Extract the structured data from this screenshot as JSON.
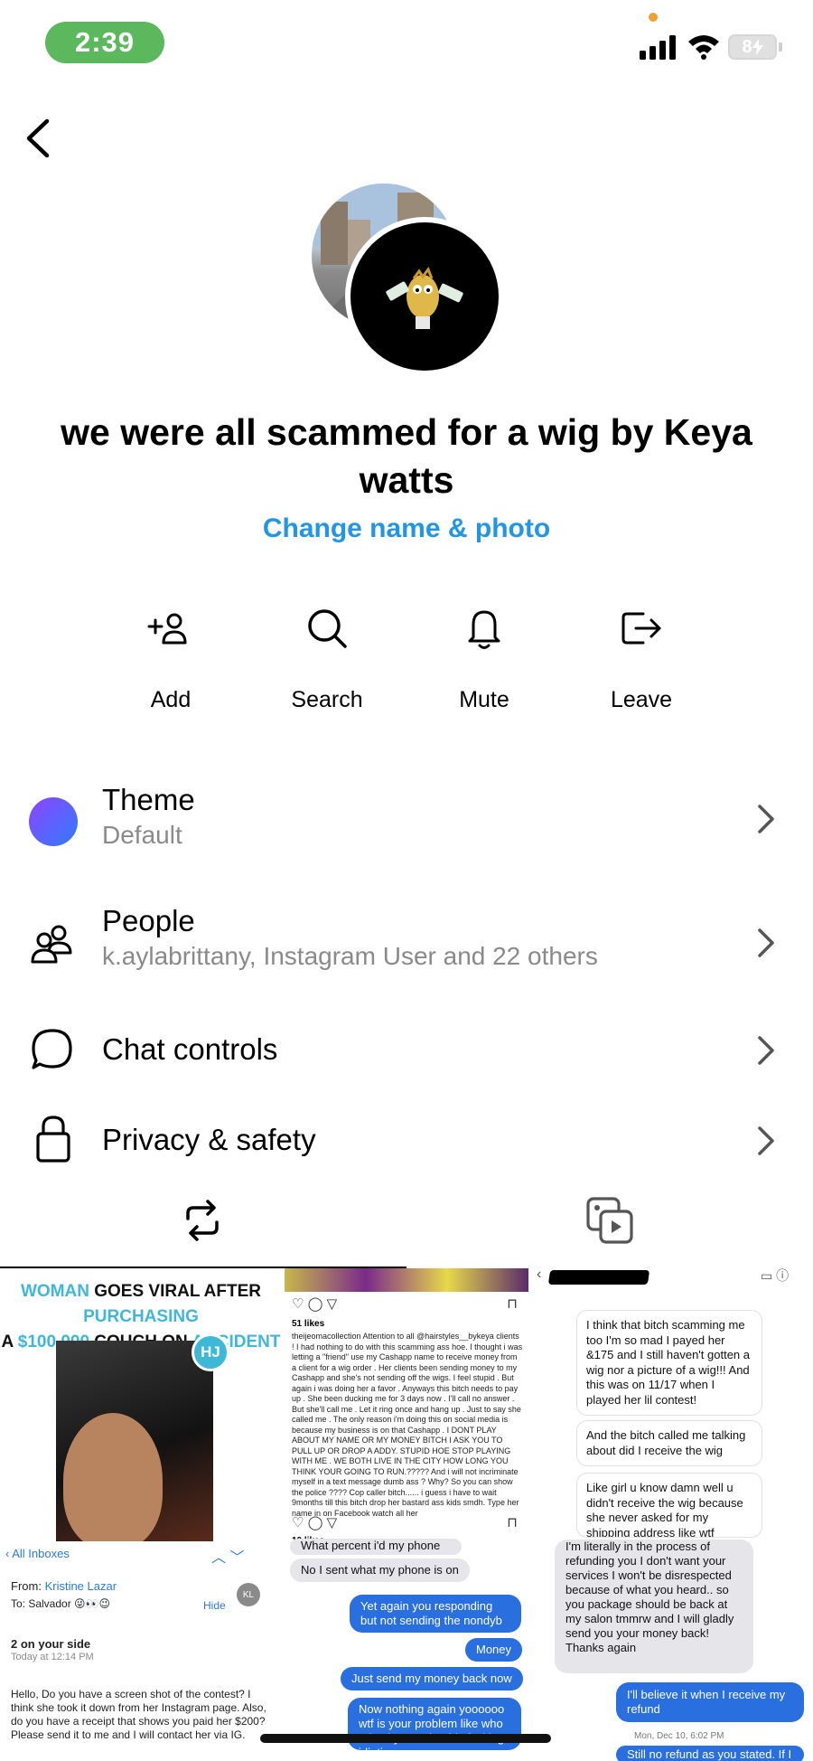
{
  "status_bar": {
    "time": "2:39",
    "battery": "8",
    "icons": [
      "signal-icon",
      "wifi-icon",
      "battery-charging-icon"
    ]
  },
  "header": {
    "back_icon": "chevron-left-icon"
  },
  "group": {
    "title": "we were all scammed for a wig by Keya watts",
    "change_label": "Change name & photo"
  },
  "actions": [
    {
      "label": "Add",
      "icon": "add-person-icon"
    },
    {
      "label": "Search",
      "icon": "search-icon"
    },
    {
      "label": "Mute",
      "icon": "bell-icon"
    },
    {
      "label": "Leave",
      "icon": "leave-icon"
    }
  ],
  "settings": {
    "theme": {
      "title": "Theme",
      "value": "Default"
    },
    "people": {
      "title": "People",
      "value": "k.aylabrittany, Instagram User and 22 others"
    },
    "chat_controls": {
      "title": "Chat controls"
    },
    "privacy": {
      "title": "Privacy & safety"
    }
  },
  "tabs": [
    {
      "icon": "repost-icon",
      "selected": true
    },
    {
      "icon": "media-gallery-icon",
      "selected": false
    }
  ],
  "media": {
    "left": {
      "headline_1": "WOMAN",
      "headline_2": " GOES VIRAL AFTER ",
      "headline_3": "PURCHASING",
      "headline_4": "A ",
      "headline_5": "$100,000",
      "headline_6": " COUCH ON ",
      "headline_7": "ACCIDENT",
      "badge": "HJ",
      "mail_inbox": "All Inboxes",
      "mail_from_label": "From: ",
      "mail_from": "Kristine Lazar",
      "mail_to": "To: Salvador 😜👀😉",
      "mail_hide": "Hide",
      "mail_avatar": "KL",
      "mail_subject": "2 on your side",
      "mail_date": "Today at 12:14 PM",
      "mail_body": "Hello, Do you have a screen shot of the contest? I think she took it down from her Instagram page. Also, do you have a receipt that shows you paid her $200? Please send it to me and I will contact her via IG."
    },
    "middle": {
      "likes_1": "51 likes",
      "caption": "theijeomacollection Attention to all @hairstyles__bykeya clients ! I had nothing to do with this scamming ass hoe. I thought i was letting a \"friend\" use my Cashapp name to receive money from a client for a wig order . Her clients been sending money to my Cashapp and she's not sending off the wigs. I feel stupid . But again i was doing her a favor . Anyways this bitch needs to pay up . She been ducking me for 3 days now . I'll call no answer . But she'll call me . Let it ring once and hang up . Just to say she called me . The only reason i'm doing this on social media is because my business is on that Cashapp . I DONT PLAY ABOUT MY NAME OR MY MONEY BITCH I ASK YOU TO PULL UP OR DROP A ADDY. STUPID HOE STOP PLAYING WITH ME . WE BOTH LIVE IN THE CITY HOW LONG YOU THINK YOUR GOING TO RUN.????? And i will not incriminate myself in a text message dumb ass ? Why? So you can show the police ???? Cop caller bitch...... i guess i have to wait 9months till this bitch drop her bastard ass kids smdh. Type her name in on Facebook watch all her",
      "likes_2": "10 likes",
      "msg_1": "What percent i'd my phone on",
      "msg_2": "No I sent what my phone is on",
      "msg_3": "Yet again you responding but not sending the nondyb",
      "msg_4": "Money",
      "msg_5": "Just send my money back now",
      "msg_6": "Now nothing again yoooooo wtf is your problem like who raised you to be this fucking idiotic"
    },
    "right": {
      "box_1": "I think that bitch scamming me too I'm so mad I payed her &175 and I still haven't gotten a wig nor a picture of a wig!!! And this was on 11/17 when I played her lil contest!",
      "box_2": "And the bitch called me talking about did I receive the wig",
      "box_3": "Like girl u know damn well u didn't receive the wig because she never asked for my shipping address like wtf",
      "msg_1": "I'm literally in the process of refunding you I don't want your services I won't be disrespected because of what you heard.. so you package should be back at my salon tmmrw and I will gladly send you your money back! Thanks again",
      "msg_2": "I'll believe it when I receive my refund",
      "date": "Mon, Dec 10, 6:02 PM",
      "msg_3": "Still no refund as you stated. If I"
    }
  },
  "colors": {
    "accent": "#2196e6",
    "sub_text": "#8a8a8a",
    "time_pill": "#5cb85c",
    "theme_gradient": [
      "#8e44ff",
      "#2f7cff"
    ]
  }
}
